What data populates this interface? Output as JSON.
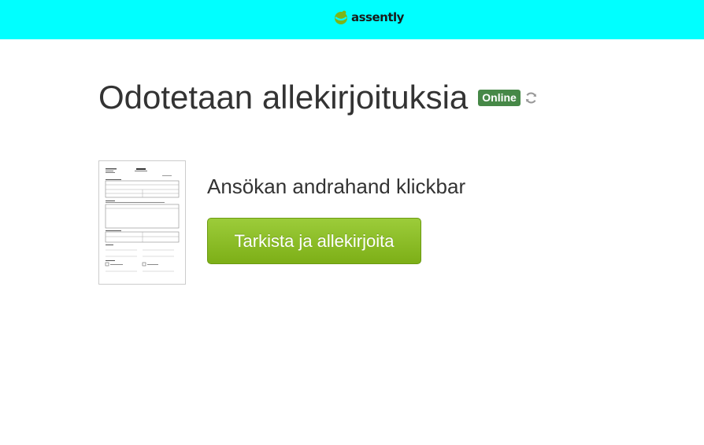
{
  "header": {
    "brand_name": "assently",
    "background_color": "#00ffff",
    "logo_icon": "assently-logo-icon"
  },
  "main": {
    "title": "Odotetaan allekirjoituksia",
    "status_badge": "Online",
    "status_color": "#468847",
    "refresh_icon": "refresh-icon",
    "document": {
      "name": "Ansökan andrahand klickbar",
      "thumbnail_icon": "document-thumbnail"
    },
    "sign_button_label": "Tarkista ja allekirjoita",
    "sign_button_color": "#7daf17"
  }
}
